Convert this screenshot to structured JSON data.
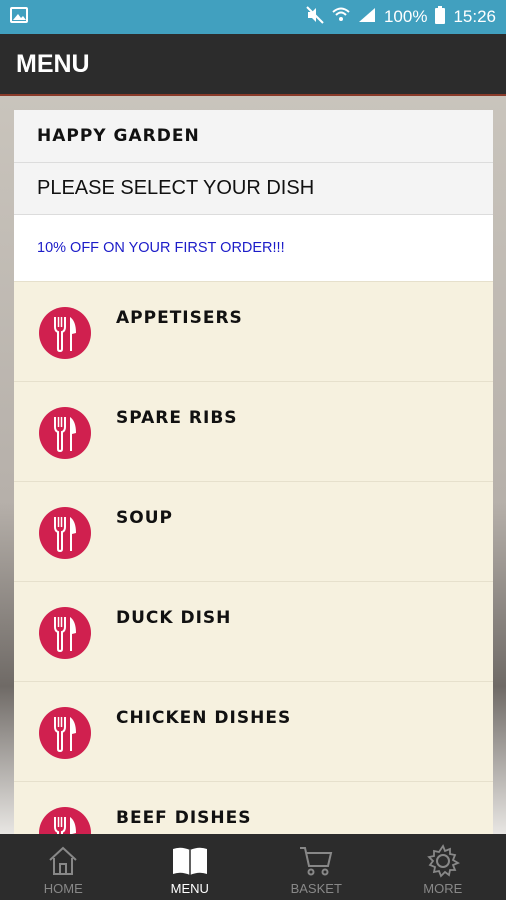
{
  "status_bar": {
    "battery": "100%",
    "time": "15:26"
  },
  "app_bar": {
    "title": "MENU"
  },
  "card": {
    "restaurant_name": "HAPPY GARDEN",
    "instruction": "PLEASE SELECT YOUR DISH",
    "promo": "10% OFF ON YOUR FIRST ORDER!!!"
  },
  "categories": [
    {
      "label": "APPETISERS"
    },
    {
      "label": "SPARE RIBS"
    },
    {
      "label": "SOUP"
    },
    {
      "label": "DUCK DISH"
    },
    {
      "label": "CHICKEN DISHES"
    },
    {
      "label": "BEEF DISHES"
    }
  ],
  "bottom_nav": {
    "tabs": [
      {
        "label": "HOME",
        "icon": "home-icon",
        "active": false
      },
      {
        "label": "MENU",
        "icon": "book-icon",
        "active": true
      },
      {
        "label": "BASKET",
        "icon": "cart-icon",
        "active": false
      },
      {
        "label": "MORE",
        "icon": "gear-icon",
        "active": false
      }
    ]
  },
  "colors": {
    "status_bar": "#41a0bf",
    "app_bar": "#2c2c2c",
    "icon_red": "#d0204f",
    "promo_text": "#1c1cc8",
    "item_bg": "#f6f1df"
  }
}
